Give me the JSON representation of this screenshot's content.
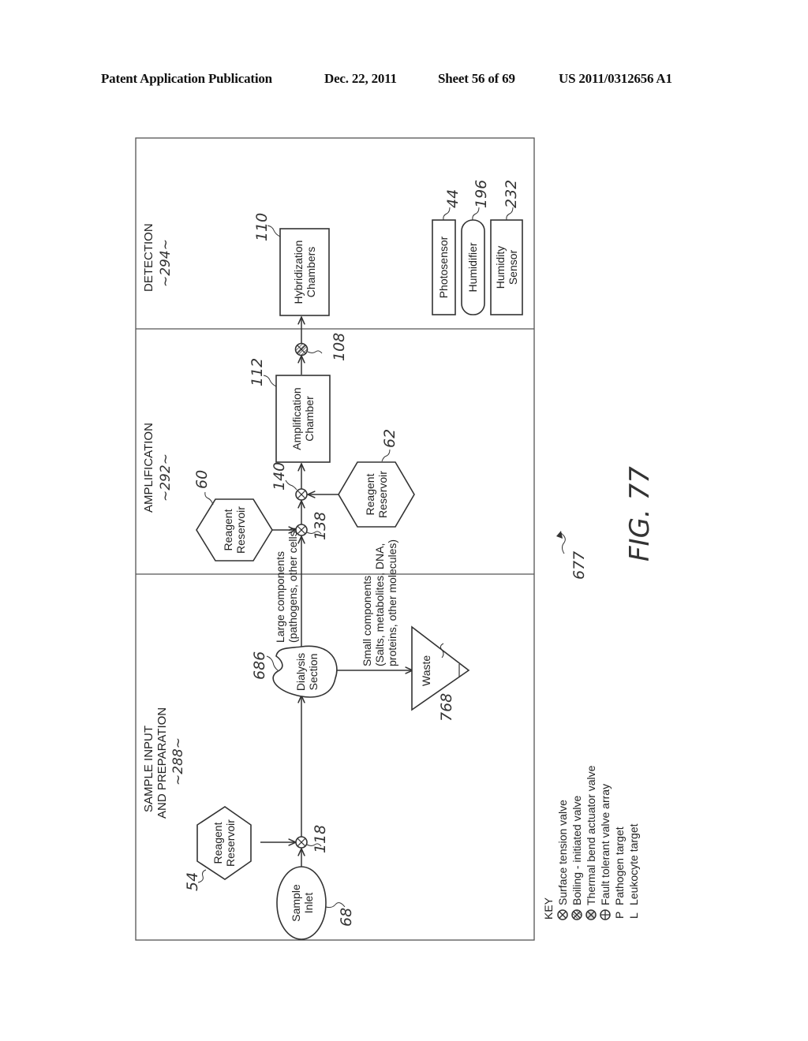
{
  "header": {
    "publication": "Patent Application Publication",
    "date": "Dec. 22, 2011",
    "sheet": "Sheet 56 of 69",
    "patent_number": "US 2011/0312656 A1"
  },
  "sections": {
    "sample": {
      "line1": "SAMPLE INPUT",
      "line2": "AND PREPARATION",
      "ref": "~288~"
    },
    "amplification": {
      "line1": "AMPLIFICATION",
      "ref": "~292~"
    },
    "detection": {
      "line1": "DETECTION",
      "ref": "~294~"
    }
  },
  "nodes": {
    "sample_inlet": {
      "line1": "Sample",
      "line2": "Inlet",
      "ref": "68"
    },
    "reagent_54": {
      "line1": "Reagent",
      "line2": "Reservoir",
      "ref": "54"
    },
    "valve_118": {
      "ref": "118"
    },
    "dialysis": {
      "line1": "Dialysis",
      "line2": "Section",
      "ref": "686"
    },
    "waste": {
      "line1": "Waste",
      "ref": "768"
    },
    "large_components": {
      "line1": "Large components",
      "line2": "(pathogens, other cells)"
    },
    "small_components": {
      "line1": "Small components",
      "line2": "(Salts, metabolites, DNA,",
      "line3": "proteins, other molecules)"
    },
    "reagent_60": {
      "line1": "Reagent",
      "line2": "Reservoir",
      "ref": "60"
    },
    "valve_138": {
      "ref": "138"
    },
    "valve_140": {
      "ref": "140"
    },
    "reagent_62": {
      "line1": "Reagent",
      "line2": "Reservoir",
      "ref": "62"
    },
    "amplification_chamber": {
      "line1": "Amplification",
      "line2": "Chamber",
      "ref": "112"
    },
    "valve_108": {
      "ref": "108"
    },
    "hybridization": {
      "line1": "Hybridization",
      "line2": "Chambers",
      "ref": "110"
    },
    "photosensor": {
      "line1": "Photosensor",
      "ref": "44"
    },
    "humidifier": {
      "line1": "Humidifier",
      "ref": "196"
    },
    "humidity_sensor": {
      "line1": "Humidity",
      "line2": "Sensor",
      "ref": "232"
    }
  },
  "figure": {
    "label": "FIG. 77",
    "ref": "677"
  },
  "key": {
    "title": "KEY",
    "items": [
      {
        "symbol": "surface-tension-valve",
        "label": "Surface tension valve"
      },
      {
        "symbol": "boiling-initiated-valve",
        "label": "Boiling - initiated valve"
      },
      {
        "symbol": "thermal-bend-actuator-valve",
        "label": "Thermal bend actuator valve"
      },
      {
        "symbol": "fault-tolerant-valve-array",
        "label": "Fault tolerant valve array"
      },
      {
        "symbol": "P",
        "label": "Pathogen target"
      },
      {
        "symbol": "L",
        "label": "Leukocyte target"
      }
    ]
  }
}
